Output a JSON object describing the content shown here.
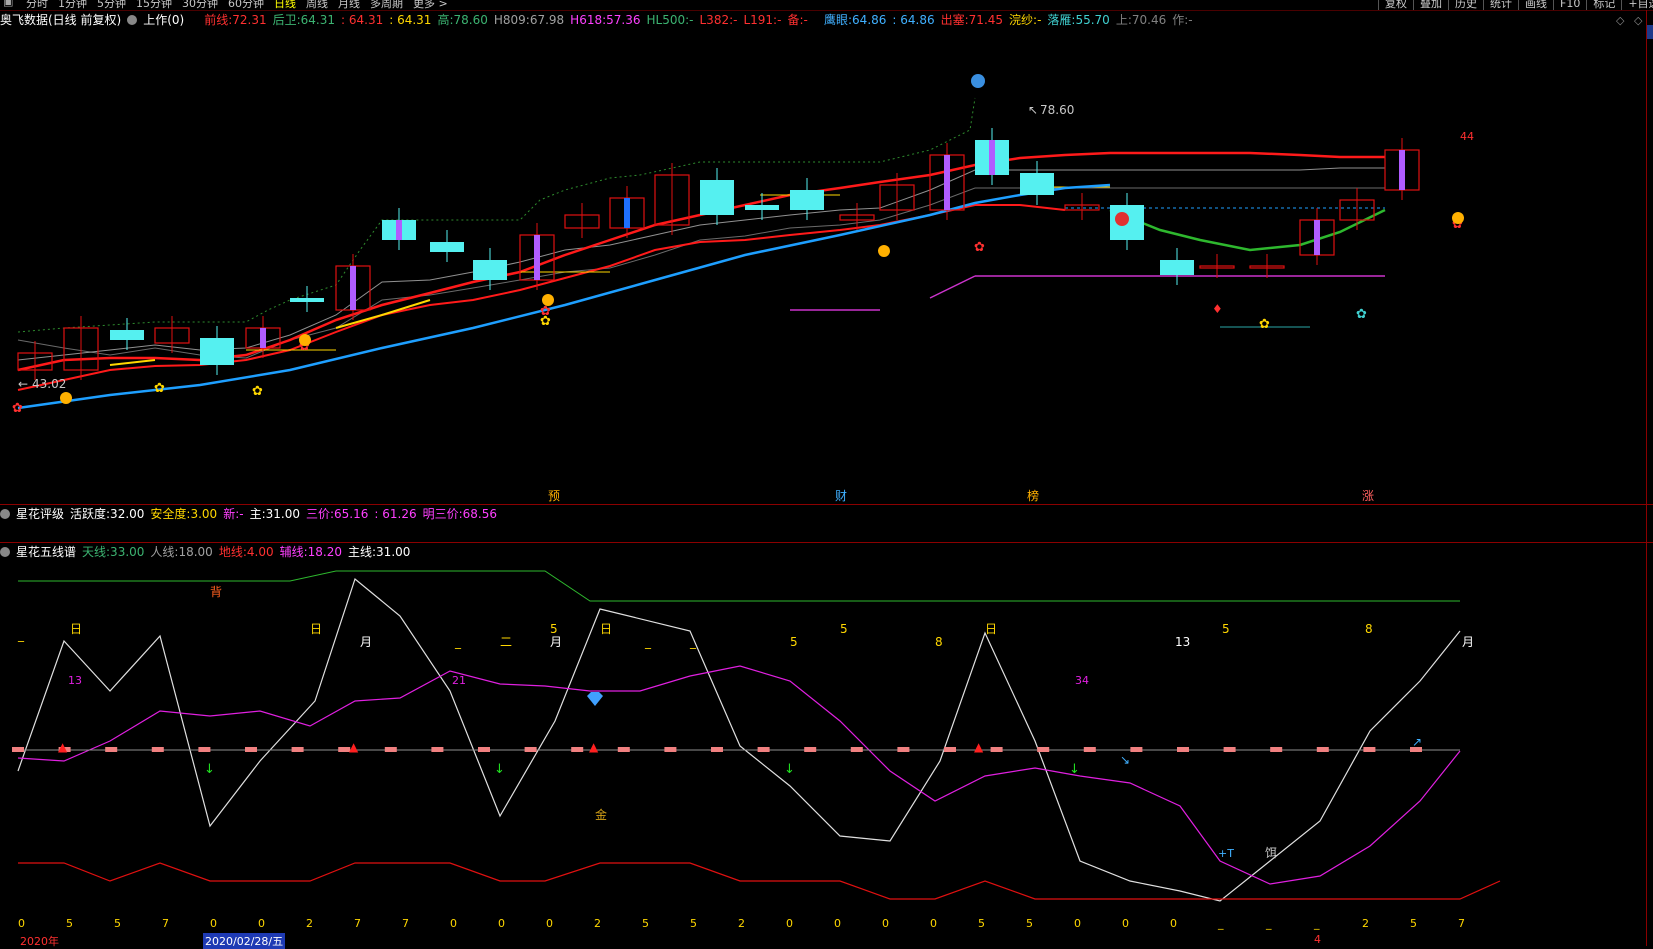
{
  "topbar": {
    "periods": [
      "分时",
      "1分钟",
      "5分钟",
      "15分钟",
      "30分钟",
      "60分钟",
      "日线",
      "周线",
      "月线",
      "多周期",
      "更多 >"
    ],
    "right_buttons": [
      "复权",
      "叠加",
      "历史",
      "统计",
      "画线",
      "F10",
      "标记",
      "+自选"
    ]
  },
  "main_header": {
    "title": "奥飞数据(日线 前复权)",
    "indicator_name": "上作(0)",
    "items": [
      {
        "label": "前线:",
        "value": "72.31",
        "color": "#ff3030"
      },
      {
        "label": "后卫:",
        "value": "64.31",
        "color": "#3cb371"
      },
      {
        "label": ": ",
        "value": "64.31",
        "color": "#ff3030"
      },
      {
        "label": ": ",
        "value": "64.31",
        "color": "#ffd700"
      },
      {
        "label": "高:",
        "value": "78.60",
        "color": "#3cb371"
      },
      {
        "label": "H809:",
        "value": "67.98",
        "color": "#a0a0a0"
      },
      {
        "label": "H618:",
        "value": "57.36",
        "color": "#ff40ff"
      },
      {
        "label": "HL500:",
        "value": "-",
        "color": "#3cb371"
      },
      {
        "label": "L382:",
        "value": "-",
        "color": "#ff3030"
      },
      {
        "label": "L191:",
        "value": "-",
        "color": "#ff3030"
      },
      {
        "label": "备:",
        "value": "-",
        "color": "#ff3030"
      }
    ],
    "items2": [
      {
        "label": "鹰眼:",
        "value": "64.86",
        "color": "#40b0ff"
      },
      {
        "label": ": ",
        "value": "64.86",
        "color": "#40b0ff"
      },
      {
        "label": "出塞:",
        "value": "71.45",
        "color": "#ff3030"
      },
      {
        "label": "浣纱:",
        "value": "-",
        "color": "#ffd700"
      },
      {
        "label": "落雁:",
        "value": "55.70",
        "color": "#40d0d0"
      },
      {
        "label": "上:",
        "value": "70.46",
        "color": "#808080"
      },
      {
        "label": "作:",
        "value": "-",
        "color": "#808080"
      }
    ]
  },
  "main_chart": {
    "high_label": "78.60",
    "low_label": "43.02",
    "last_count": "44",
    "markers": [
      "预",
      "财",
      "榜",
      "涨"
    ]
  },
  "panel2": {
    "title": "星花评级",
    "items": [
      {
        "label": "活跃度:",
        "value": "32.00",
        "color": "#ffffff"
      },
      {
        "label": "安全度:",
        "value": "3.00",
        "color": "#ffd700"
      },
      {
        "label": "新:",
        "value": "-",
        "color": "#ff40ff"
      },
      {
        "label": "主:",
        "value": "31.00",
        "color": "#ffffff"
      },
      {
        "label": "三价:",
        "value": "65.16",
        "color": "#ff40ff"
      },
      {
        "label": ": ",
        "value": "61.26",
        "color": "#ff40ff"
      },
      {
        "label": "明三价:",
        "value": "68.56",
        "color": "#ff40ff"
      }
    ]
  },
  "panel3": {
    "title": "星花五线谱",
    "items": [
      {
        "label": "天线:",
        "value": "33.00",
        "color": "#3cb371"
      },
      {
        "label": "人线:",
        "value": "18.00",
        "color": "#a0a0a0"
      },
      {
        "label": "地线:",
        "value": "4.00",
        "color": "#ff3030"
      },
      {
        "label": "辅线:",
        "value": "18.20",
        "color": "#ff40ff"
      },
      {
        "label": "主线:",
        "value": "31.00",
        "color": "#ffffff"
      }
    ],
    "top_labels": [
      "_",
      "日",
      "日",
      "月",
      "_",
      "二",
      "5",
      "月",
      "日",
      "_",
      "_",
      "5",
      "5",
      "8",
      "日",
      "13",
      "5",
      "8",
      "月"
    ],
    "mid_numbers": [
      "13",
      "21",
      "34"
    ],
    "special": {
      "bei": "背",
      "jin": "金",
      "t": "+T",
      "er": "饵"
    },
    "bottom_numbers": [
      "0",
      "5",
      "5",
      "7",
      "0",
      "0",
      "2",
      "7",
      "7",
      "0",
      "0",
      "0",
      "2",
      "5",
      "5",
      "2",
      "0",
      "0",
      "0",
      "0",
      "5",
      "5",
      "0",
      "0",
      "0",
      "_",
      "_",
      "_",
      "2",
      "5",
      "7"
    ]
  },
  "datebar": {
    "year": "2020年",
    "date": "2020/02/28/五",
    "right_mark": "4"
  }
}
